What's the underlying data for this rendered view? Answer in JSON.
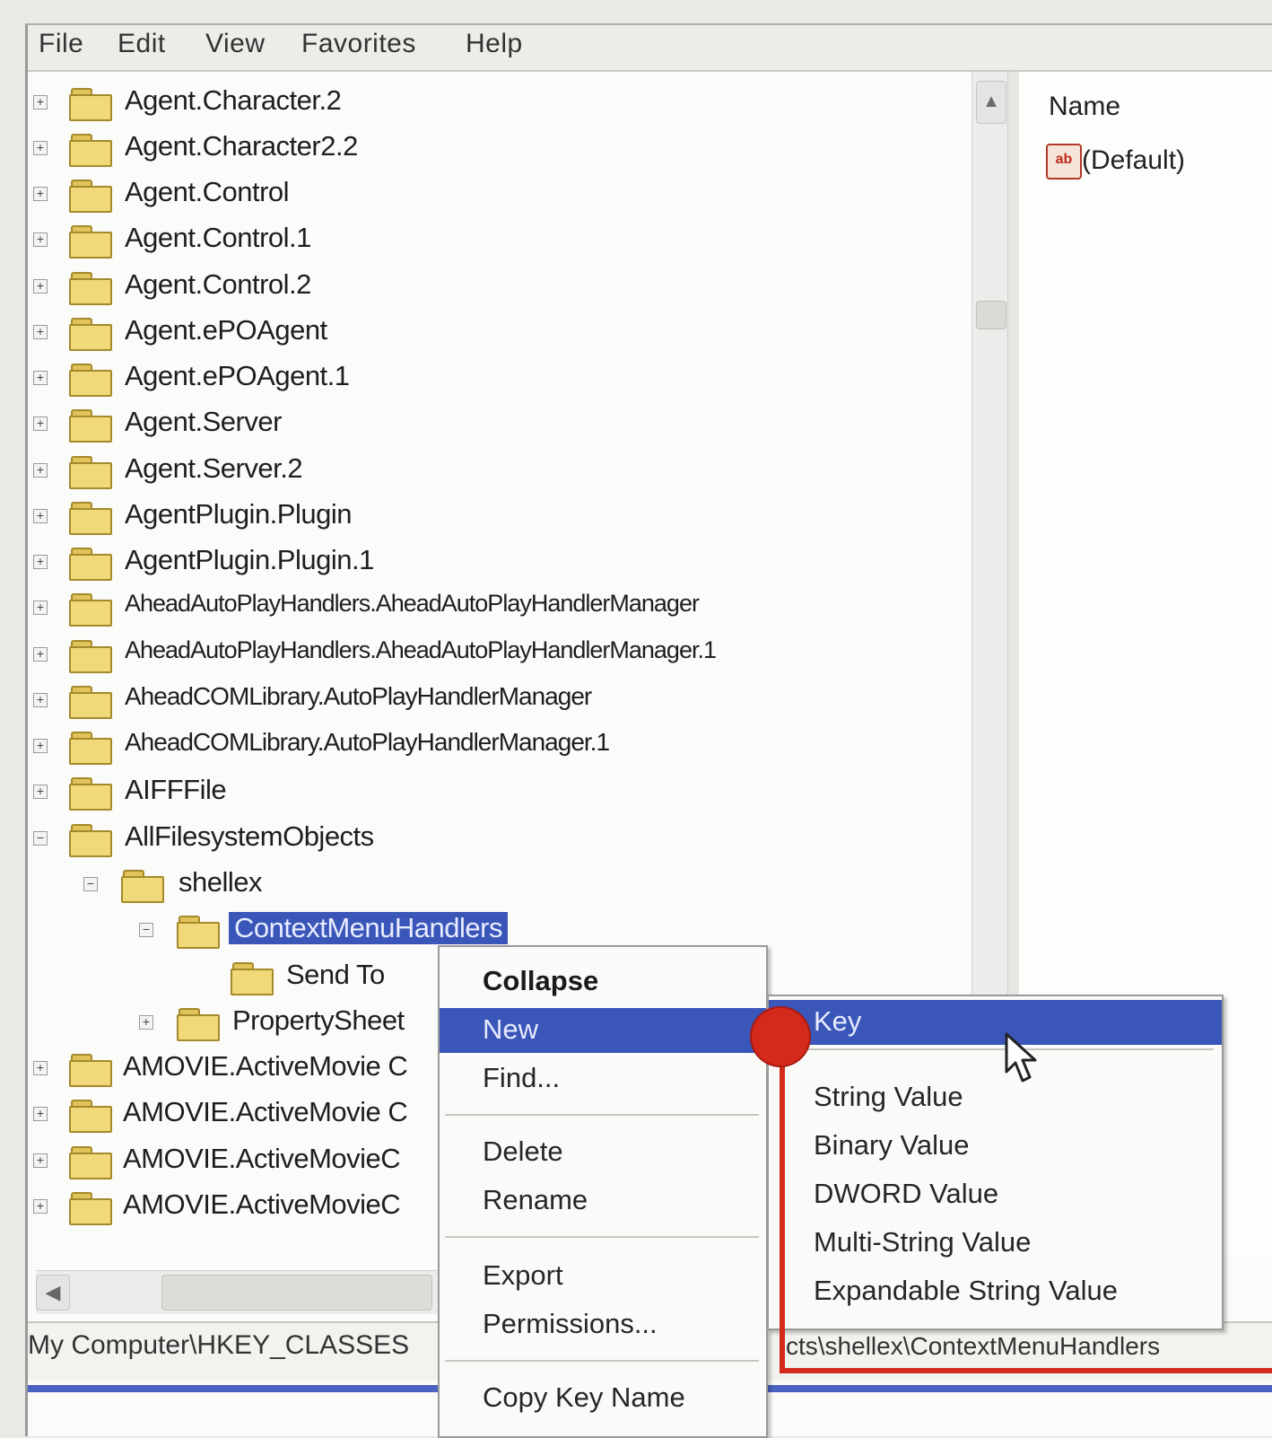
{
  "menubar": {
    "file": "File",
    "edit": "Edit",
    "view": "View",
    "favorites": "Favorites",
    "help": "Help"
  },
  "tree": {
    "items": [
      {
        "label": "Agent.Character.2"
      },
      {
        "label": "Agent.Character2.2"
      },
      {
        "label": "Agent.Control"
      },
      {
        "label": "Agent.Control.1"
      },
      {
        "label": "Agent.Control.2"
      },
      {
        "label": "Agent.ePOAgent"
      },
      {
        "label": "Agent.ePOAgent.1"
      },
      {
        "label": "Agent.Server"
      },
      {
        "label": "Agent.Server.2"
      },
      {
        "label": "AgentPlugin.Plugin"
      },
      {
        "label": "AgentPlugin.Plugin.1"
      },
      {
        "label": "AheadAutoPlayHandlers.AheadAutoPlayHandlerManager"
      },
      {
        "label": "AheadAutoPlayHandlers.AheadAutoPlayHandlerManager.1"
      },
      {
        "label": "AheadCOMLibrary.AutoPlayHandlerManager"
      },
      {
        "label": "AheadCOMLibrary.AutoPlayHandlerManager.1"
      },
      {
        "label": "AIFFFile"
      },
      {
        "label": "AllFilesystemObjects"
      },
      {
        "label": "shellex"
      },
      {
        "label": "ContextMenuHandlers"
      },
      {
        "label": "Send To"
      },
      {
        "label": "PropertySheet"
      },
      {
        "label": "AMOVIE.ActiveMovie C"
      },
      {
        "label": "AMOVIE.ActiveMovie C"
      },
      {
        "label": "AMOVIE.ActiveMovieC"
      },
      {
        "label": "AMOVIE.ActiveMovieC"
      }
    ]
  },
  "right_pane": {
    "column_name": "Name",
    "value_icon": "ab",
    "value_name": "(Default)"
  },
  "status": {
    "path_left": "My Computer\\HKEY_CLASSES",
    "path_right": "cts\\shellex\\ContextMenuHandlers"
  },
  "context_menu": {
    "collapse": "Collapse",
    "new": "New",
    "find": "Find...",
    "delete": "Delete",
    "rename": "Rename",
    "export": "Export",
    "permissions": "Permissions...",
    "copy_key_name": "Copy Key Name"
  },
  "submenu": {
    "key": "Key",
    "string_value": "String Value",
    "binary_value": "Binary Value",
    "dword_value": "DWORD Value",
    "multi_string_value": "Multi-String Value",
    "expandable_string_value": "Expandable String Value"
  },
  "colors": {
    "selection": "#3a56b8",
    "annotation": "#d42a1c",
    "folder": "#f1d878"
  },
  "icons": {
    "folder": "folder-icon",
    "string_value": "string-value-icon",
    "cursor": "mouse-cursor-icon"
  }
}
